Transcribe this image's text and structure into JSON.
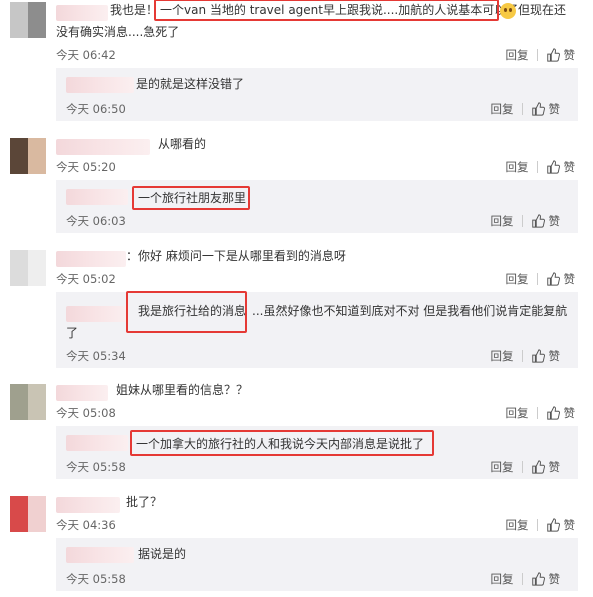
{
  "actions": {
    "reply_label": "回复",
    "like_label": "赞"
  },
  "comments": [
    {
      "text_a": "我也是！",
      "text_b": "一个van 当地的 travel agent早上跟我说....加航的人说基本可以了",
      "text_c": "但现在还",
      "text_d": "没有确实消息....急死了",
      "time": "今天 06:42",
      "reply": {
        "text": "是的就是这样没错了",
        "time": "今天 06:50"
      }
    },
    {
      "text_a": "从哪看的",
      "time": "今天 05:20",
      "reply": {
        "text": "一个旅行社朋友那里",
        "time": "今天 06:03"
      }
    },
    {
      "text_a": "：你好 麻烦问一下是从哪里看到的消息呀",
      "time": "今天 05:02",
      "reply": {
        "text_a": "我是旅行社给的消息",
        "text_b": "...虽然好像也不知道到底对不对 但是我看他们说肯定能复航",
        "text_c": "了",
        "time": "今天 05:34"
      }
    },
    {
      "text_a": "姐妹从哪里看的信息？？",
      "time": "今天 05:08",
      "reply": {
        "text": "一个加拿大的旅行社的人和我说今天内部消息是说批了",
        "time": "今天 05:58"
      }
    },
    {
      "text_a": "批了？",
      "time": "今天 04:36",
      "reply": {
        "text": "据说是的",
        "time": "今天 05:58"
      }
    }
  ],
  "colors": {
    "highlight": "#e53935",
    "reply_bg": "#f2f2f5",
    "time": "#666666"
  },
  "icons": {
    "like": "thumbs-up-icon",
    "emoji": "worried-face-emoji"
  }
}
